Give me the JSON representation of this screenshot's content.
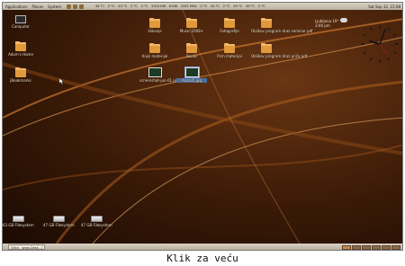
{
  "top_panel": {
    "menus": [
      "Applications",
      "Places",
      "System"
    ],
    "monitors": [
      "44 °C",
      "2 °C",
      "43 °C",
      "2 °C",
      "2 °C",
      "2515 KiB",
      "6 KiB",
      "2551 MHz",
      "2 °C",
      "44 °C",
      "2 °C",
      "43 °C",
      "49 °C",
      "2 °C"
    ],
    "clock": "Sat Sep 12, 15:08"
  },
  "desktop": {
    "left_icons": [
      {
        "name": "computer",
        "label": "Computer"
      },
      {
        "name": "home",
        "label": "Adam's Home"
      },
      {
        "name": "bookmarks",
        "label": "jBookmarks"
      }
    ],
    "folders": [
      {
        "label": "Slikanje"
      },
      {
        "label": "Music 2008+"
      },
      {
        "label": "Fotografije"
      },
      {
        "label": "Oblikov program draz seminar pdf"
      },
      {
        "label": "Knjiz materijal"
      },
      {
        "label": "Books"
      },
      {
        "label": "Pcm materijal"
      },
      {
        "label": "Oblikov program draz priča pdf"
      }
    ],
    "images": [
      {
        "label": "screenshot-jun-01.jpg"
      },
      {
        "label": "Azuzu5.jpg"
      }
    ],
    "drives": [
      {
        "label": "63 GB Filesystem"
      },
      {
        "label": "47 GB Filesystem"
      },
      {
        "label": "47 GB Filesystem"
      }
    ]
  },
  "weather": {
    "location": "Ljubljana",
    "temp": "19°",
    "time": "3:00 pm"
  },
  "bottom_panel": {
    "task": "[Xfce - www.Desk...]",
    "workspaces": 6
  },
  "caption": "Klik za veću"
}
